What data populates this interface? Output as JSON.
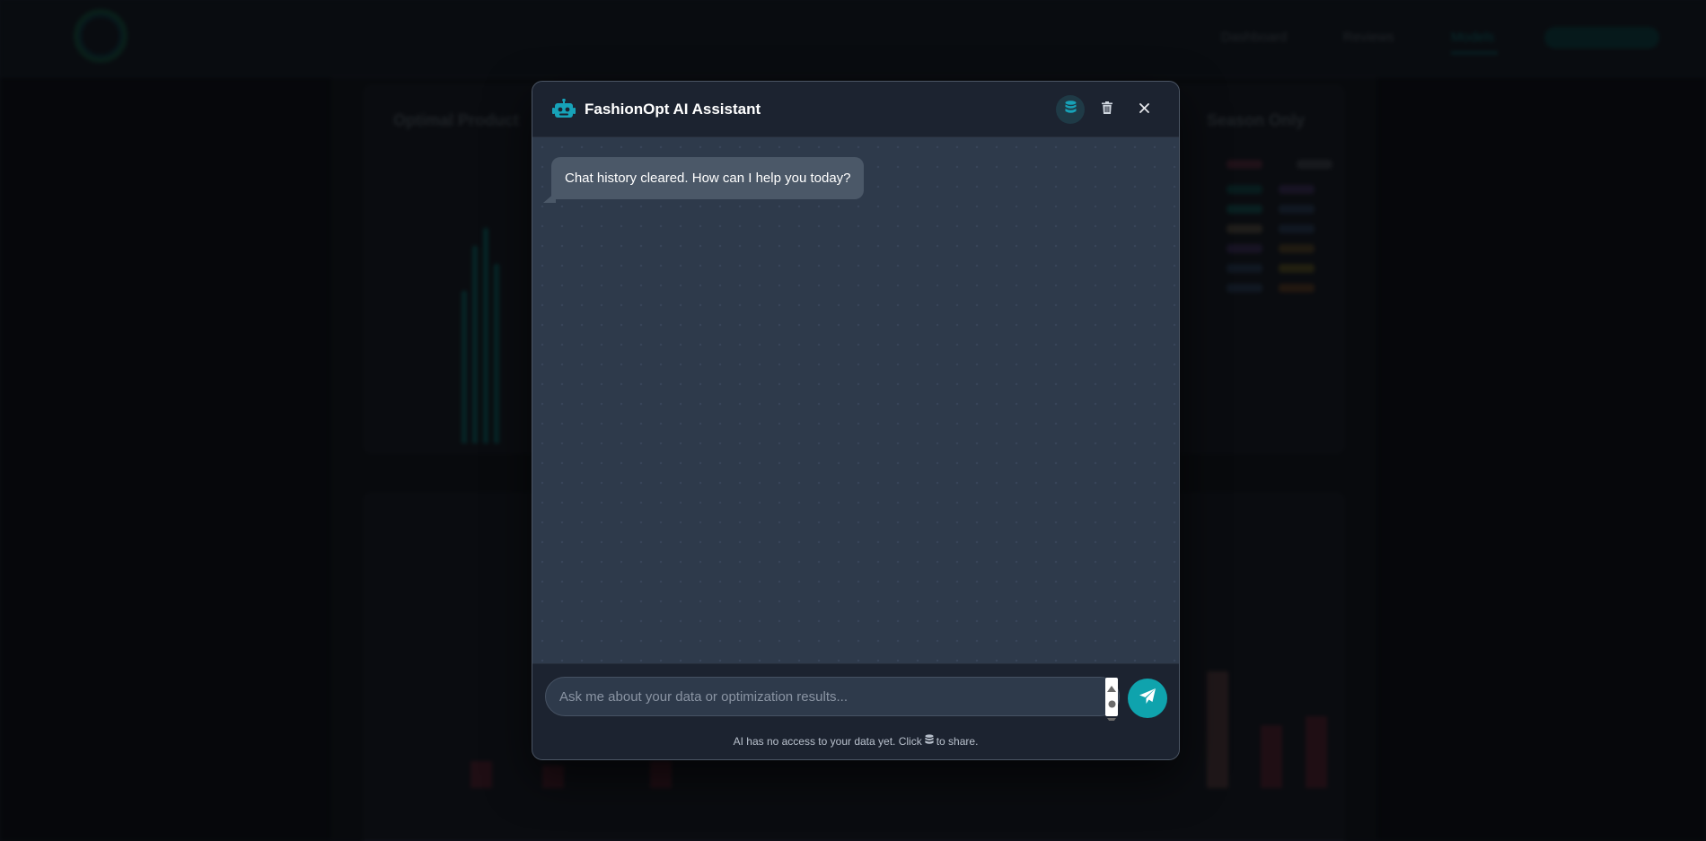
{
  "background": {
    "nav": [
      "Dashboard",
      "Reviews",
      "Models"
    ],
    "card_title_left": "Optimal Product",
    "card_title_right": "Season Only"
  },
  "chat": {
    "title": "FashionOpt AI Assistant",
    "header_icons": [
      "database-icon",
      "trash-icon",
      "close-icon"
    ],
    "messages": [
      {
        "role": "assistant",
        "text": "Chat history cleared. How can I help you today?"
      }
    ],
    "input": {
      "value": "",
      "placeholder": "Ask me about your data or optimization results..."
    },
    "footer": {
      "before": "AI has no access to your data yet. Click",
      "after": "to share."
    }
  },
  "colors": {
    "accent": "#0fa3ad",
    "header_bg": "#1c2330",
    "body_bg": "#2e3a4b",
    "bubble_bg": "#4b5868"
  }
}
